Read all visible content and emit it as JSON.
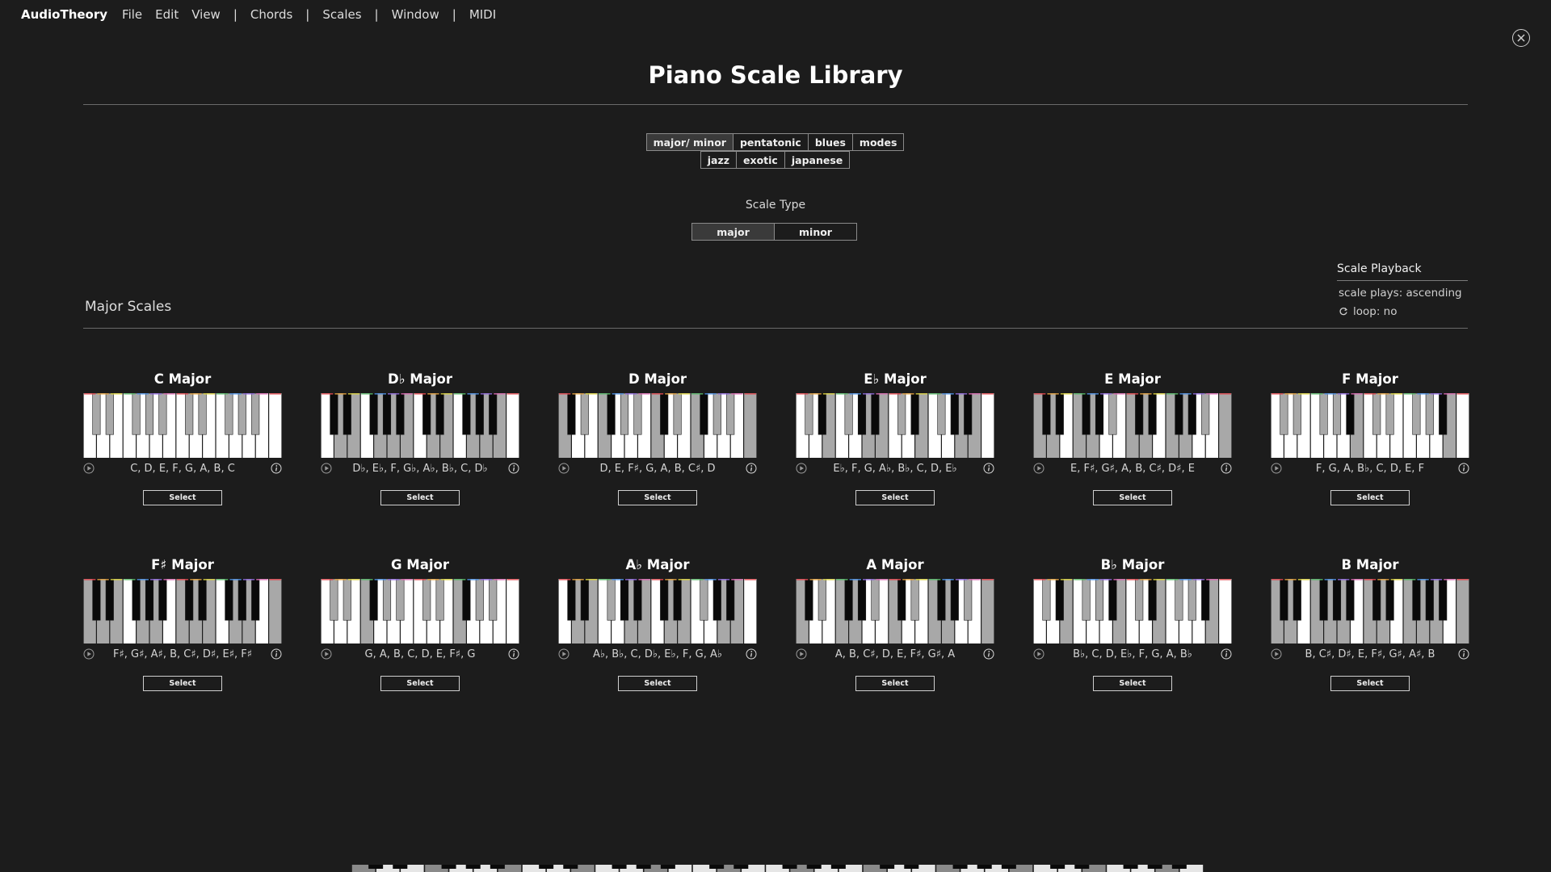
{
  "app": {
    "brand": "AudioTheory",
    "menu": [
      "File",
      "Edit",
      "View",
      "Chords",
      "Scales",
      "Window",
      "MIDI"
    ]
  },
  "page_title": "Piano Scale Library",
  "categories": {
    "row1": [
      {
        "label": "major/ minor",
        "active": true
      },
      {
        "label": "pentatonic",
        "active": false
      },
      {
        "label": "blues",
        "active": false
      },
      {
        "label": "modes",
        "active": false
      }
    ],
    "row2": [
      {
        "label": "jazz",
        "active": false
      },
      {
        "label": "exotic",
        "active": false
      },
      {
        "label": "japanese",
        "active": false
      }
    ]
  },
  "scale_type": {
    "label": "Scale Type",
    "options": [
      {
        "label": "major",
        "active": true
      },
      {
        "label": "minor",
        "active": false
      }
    ]
  },
  "playback": {
    "title": "Scale Playback",
    "plays": "scale plays: ascending",
    "loop": "loop: no"
  },
  "section_title": "Major Scales",
  "select_label": "Select",
  "colors": {
    "background": "#1c1c1c",
    "white_key": "#ffffff",
    "black_key": "#0a0a0a",
    "inactive_white_key": "#a8a8a8",
    "inactive_black_key": "#a8a8a8"
  },
  "scales": [
    {
      "name": "C Major",
      "notes": "C, D, E, F, G, A, B, C",
      "pcs": [
        0,
        2,
        4,
        5,
        7,
        9,
        11
      ]
    },
    {
      "name": "D♭ Major",
      "notes": "D♭, E♭, F, G♭, A♭, B♭, C, D♭",
      "pcs": [
        1,
        3,
        5,
        6,
        8,
        10,
        0
      ]
    },
    {
      "name": "D Major",
      "notes": "D, E, F♯, G, A, B, C♯, D",
      "pcs": [
        2,
        4,
        6,
        7,
        9,
        11,
        1
      ]
    },
    {
      "name": "E♭ Major",
      "notes": "E♭, F, G, A♭, B♭, C, D, E♭",
      "pcs": [
        3,
        5,
        7,
        8,
        10,
        0,
        2
      ]
    },
    {
      "name": "E Major",
      "notes": "E, F♯, G♯, A, B, C♯, D♯, E",
      "pcs": [
        4,
        6,
        8,
        9,
        11,
        1,
        3
      ]
    },
    {
      "name": "F Major",
      "notes": "F, G, A, B♭, C, D, E, F",
      "pcs": [
        5,
        7,
        9,
        10,
        0,
        2,
        4
      ]
    },
    {
      "name": "F♯ Major",
      "notes": "F♯, G♯, A♯, B, C♯, D♯, E♯, F♯",
      "pcs": [
        6,
        8,
        10,
        11,
        1,
        3,
        5
      ]
    },
    {
      "name": "G Major",
      "notes": "G, A, B, C, D, E, F♯, G",
      "pcs": [
        7,
        9,
        11,
        0,
        2,
        4,
        6
      ]
    },
    {
      "name": "A♭ Major",
      "notes": "A♭, B♭, C, D♭, E♭, F, G, A♭",
      "pcs": [
        8,
        10,
        0,
        1,
        3,
        5,
        7
      ]
    },
    {
      "name": "A Major",
      "notes": "A, B, C♯, D, E, F♯, G♯, A",
      "pcs": [
        9,
        11,
        1,
        2,
        4,
        6,
        8
      ]
    },
    {
      "name": "B♭ Major",
      "notes": "B♭, C, D, E♭, F, G, A, B♭",
      "pcs": [
        10,
        0,
        2,
        3,
        5,
        7,
        9
      ]
    },
    {
      "name": "B Major",
      "notes": "B, C♯, D♯, E, F♯, G♯, A♯, B",
      "pcs": [
        11,
        1,
        3,
        4,
        6,
        8,
        10
      ]
    }
  ]
}
